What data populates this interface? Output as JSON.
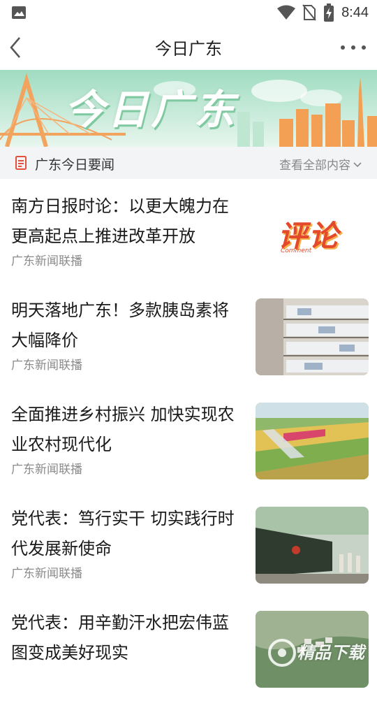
{
  "status_bar": {
    "time": "8:44"
  },
  "nav": {
    "title": "今日广东"
  },
  "banner": {
    "text": "今日广东"
  },
  "section": {
    "title": "广东今日要闻",
    "more_label": "查看全部内容"
  },
  "news": [
    {
      "title": "南方日报时论：以更大魄力在更高起点上推进改革开放",
      "source": "广东新闻联播",
      "thumb_text": "评论",
      "thumb_sub": "Comment"
    },
    {
      "title": "明天落地广东！多款胰岛素将大幅降价",
      "source": "广东新闻联播"
    },
    {
      "title": "全面推进乡村振兴 加快实现农业农村现代化",
      "source": "广东新闻联播"
    },
    {
      "title": "党代表：笃行实干 切实践行时代发展新使命",
      "source": "广东新闻联播"
    },
    {
      "title": "党代表：用辛勤汗水把宏伟蓝图变成美好现实",
      "source": ""
    }
  ],
  "watermark": {
    "text": "精品下载"
  },
  "colors": {
    "accent": "#e2513b",
    "section_bg": "#f3f4f6",
    "banner_green": "#c9ead3",
    "banner_orange": "#f2a35d"
  }
}
